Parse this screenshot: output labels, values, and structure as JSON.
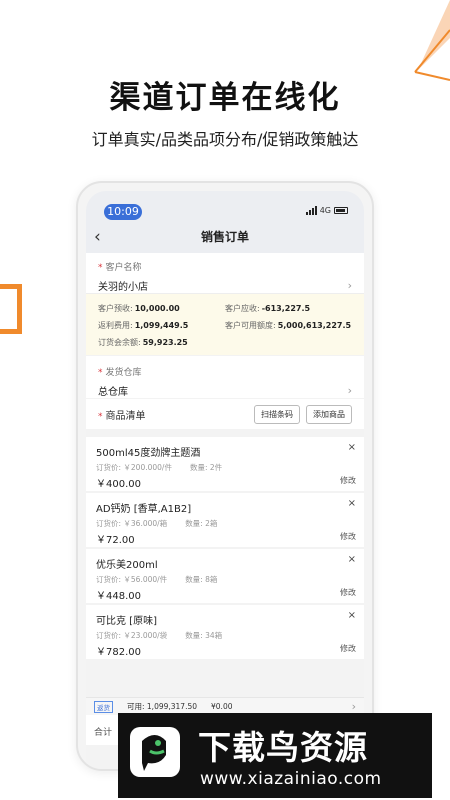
{
  "headline": "渠道订单在线化",
  "subline": "订单真实/品类品项分布/促销政策触达",
  "colors": {
    "accent": "#f08a2c",
    "blue": "#3a6fd8",
    "warn_bg": "#fdfaea"
  },
  "phone": {
    "status": {
      "time": "10:09",
      "network": "4G"
    },
    "nav": {
      "back_icon": "chevron-left-icon",
      "title": "销售订单"
    },
    "customer": {
      "label": "客户名称",
      "value": "关羽的小店"
    },
    "finance": {
      "prepay_label": "客户预收:",
      "prepay_value": "10,000.00",
      "receivable_label": "客户应收:",
      "receivable_value": "-613,227.5",
      "rebate_label": "返利费用:",
      "rebate_value": "1,099,449.5",
      "credit_label": "客户可用额度:",
      "credit_value": "5,000,613,227.5",
      "balance_label": "订货会余额:",
      "balance_value": "59,923.25"
    },
    "warehouse": {
      "label": "发货仓库",
      "value": "总仓库"
    },
    "goods": {
      "title": "商品清单",
      "scan_button": "扫描条码",
      "add_button": "添加商品"
    },
    "items": [
      {
        "name": "500ml45度劲牌主题酒",
        "unit_price": "订货价: ￥200.000/件",
        "qty": "数量: 2件",
        "total": "￥400.00",
        "edit": "修改",
        "remove": "×"
      },
      {
        "name": "AD钙奶 [香草,A1B2]",
        "unit_price": "订货价: ￥36.000/箱",
        "qty": "数量: 2箱",
        "total": "￥72.00",
        "edit": "修改",
        "remove": "×"
      },
      {
        "name": "优乐美200ml",
        "unit_price": "订货价: ￥56.000/件",
        "qty": "数量: 8箱",
        "total": "￥448.00",
        "edit": "修改",
        "remove": "×"
      },
      {
        "name": "可比克 [原味]",
        "unit_price": "订货价: ￥23.000/袋",
        "qty": "数量: 34箱",
        "total": "￥782.00",
        "edit": "修改",
        "remove": "×"
      }
    ],
    "rebate_bar": {
      "tag": "返货",
      "available": "可用: 1,099,317.50",
      "used": "¥0.00"
    },
    "total_label": "合计"
  },
  "watermark": {
    "title": "下载鸟资源",
    "url": "www.xiazainiao.com"
  }
}
